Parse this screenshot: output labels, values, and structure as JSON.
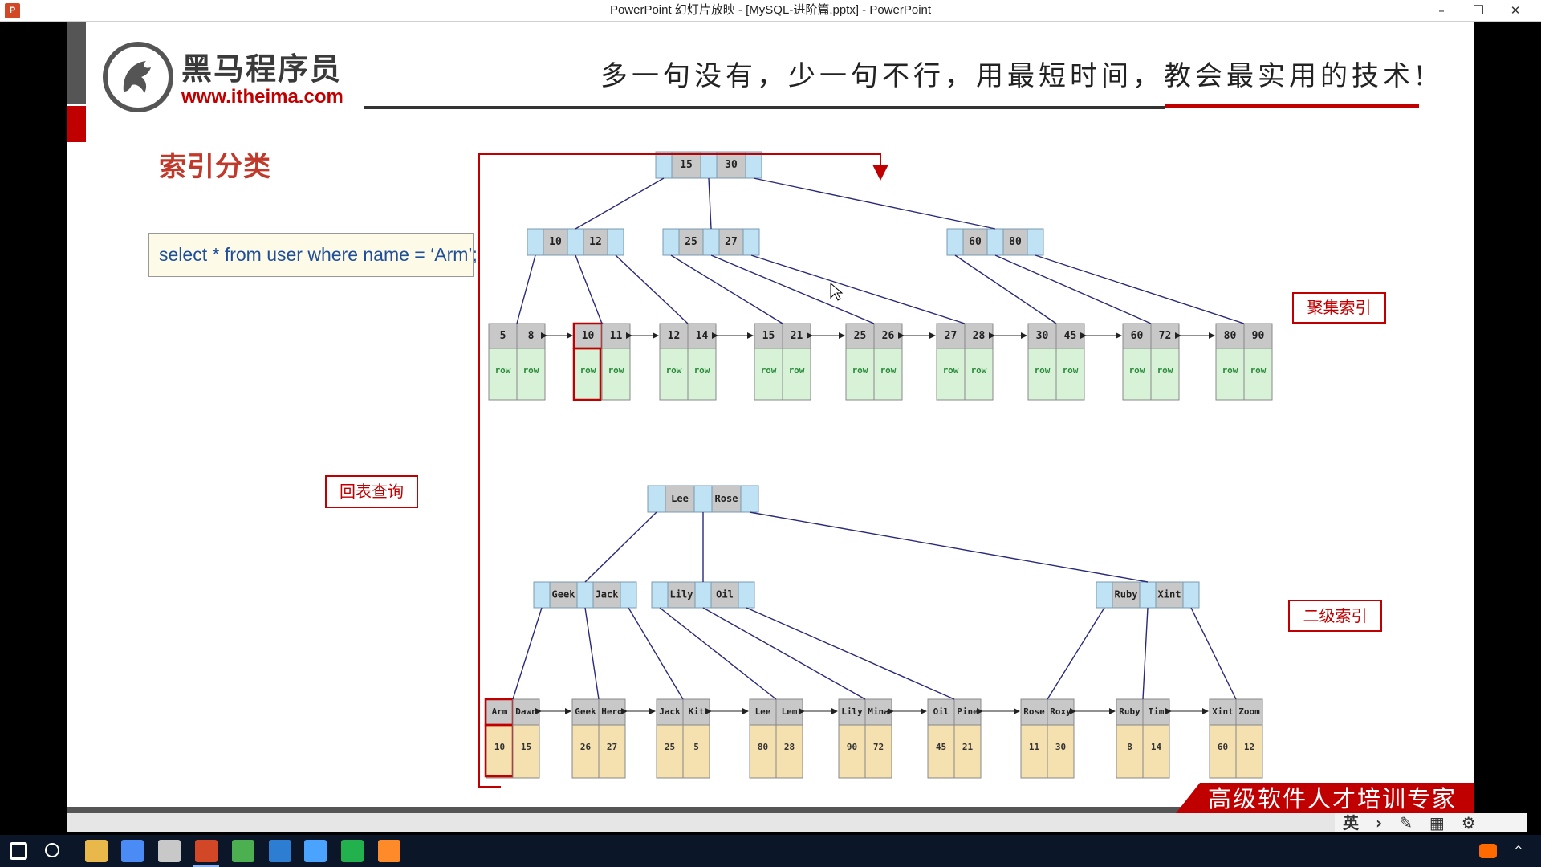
{
  "window": {
    "title": "PowerPoint 幻灯片放映 - [MySQL-进阶篇.pptx] - PowerPoint",
    "minimize_symbol": "–",
    "restore_symbol": "❐",
    "close_symbol": "✕"
  },
  "slide": {
    "logo": {
      "name": "黑马程序员",
      "url": "www.itheima.com"
    },
    "slogan": "多一句没有，少一句不行，用最短时间，教会最实用的技术!",
    "heading": "索引分类",
    "sql": "select * from user where name = ‘Arm’;",
    "labels": {
      "clustered": "聚集索引",
      "lookup": "回表查询",
      "secondary": "二级索引"
    },
    "banner": "高级软件人才培训专家",
    "clustered_tree": {
      "root": [
        "15",
        "30"
      ],
      "internal": [
        [
          "10",
          "12"
        ],
        [
          "25",
          "27"
        ],
        [
          "60",
          "80"
        ]
      ],
      "leaves": [
        [
          "5",
          "8"
        ],
        [
          "10",
          "11"
        ],
        [
          "12",
          "14"
        ],
        [
          "15",
          "21"
        ],
        [
          "25",
          "26"
        ],
        [
          "27",
          "28"
        ],
        [
          "30",
          "45"
        ],
        [
          "60",
          "72"
        ],
        [
          "80",
          "90"
        ]
      ],
      "row_label": "row",
      "highlighted_key": "10"
    },
    "secondary_tree": {
      "root": [
        "Lee",
        "Rose"
      ],
      "internal": [
        [
          "Geek",
          "Jack"
        ],
        [
          "Lily",
          "Oil"
        ],
        [
          "Ruby",
          "Xint"
        ]
      ],
      "leaves": [
        {
          "keys": [
            "Arm",
            "Dawn"
          ],
          "ids": [
            "10",
            "15"
          ]
        },
        {
          "keys": [
            "Geek",
            "Hero"
          ],
          "ids": [
            "26",
            "27"
          ]
        },
        {
          "keys": [
            "Jack",
            "Kit"
          ],
          "ids": [
            "25",
            "5"
          ]
        },
        {
          "keys": [
            "Lee",
            "Lem"
          ],
          "ids": [
            "80",
            "28"
          ]
        },
        {
          "keys": [
            "Lily",
            "Mina"
          ],
          "ids": [
            "90",
            "72"
          ]
        },
        {
          "keys": [
            "Oil",
            "Pine"
          ],
          "ids": [
            "45",
            "21"
          ]
        },
        {
          "keys": [
            "Rose",
            "Roxy"
          ],
          "ids": [
            "11",
            "30"
          ]
        },
        {
          "keys": [
            "Ruby",
            "Tim"
          ],
          "ids": [
            "8",
            "14"
          ]
        },
        {
          "keys": [
            "Xint",
            "Zoom"
          ],
          "ids": [
            "60",
            "12"
          ]
        }
      ],
      "highlighted_key": "Arm"
    },
    "colors": {
      "accent_red": "#c00000",
      "key_cell": "#c8c8c8",
      "pointer_cell": "#bfe3f5",
      "row_cell": "#d8f2d8",
      "id_cell": "#f5e0b0",
      "edge": "#2a2a7a"
    }
  },
  "statusbar": {
    "ime": "英"
  },
  "taskbar": {
    "icons": [
      "windows-start-icon",
      "search-icon",
      "file-explorer-icon",
      "chrome-icon",
      "browser-icon",
      "powerpoint-icon",
      "notepad-icon",
      "app-icon",
      "remote-desktop-icon",
      "datagrip-icon",
      "app-orange-icon"
    ]
  }
}
